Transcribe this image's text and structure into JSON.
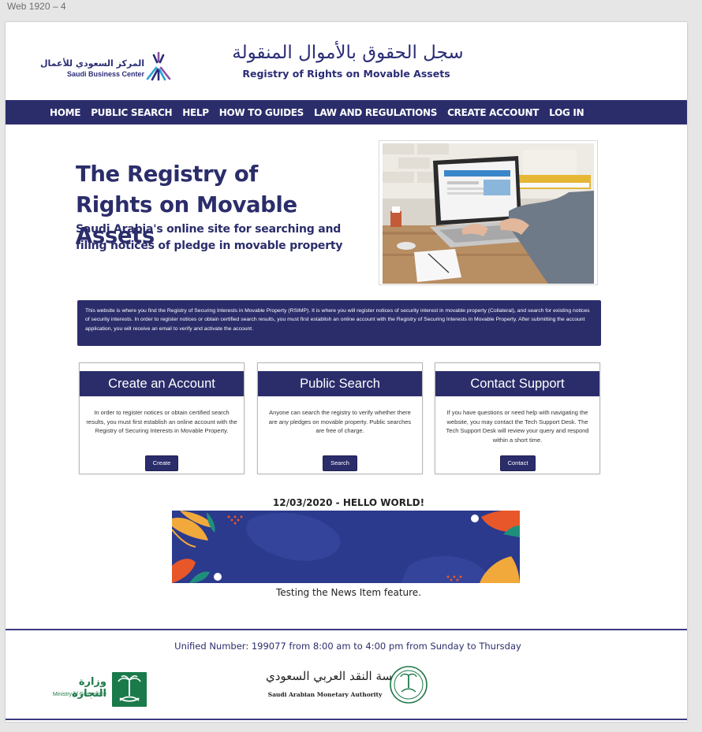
{
  "frame": {
    "title": "Web 1920 – 4"
  },
  "header": {
    "sbc_logo_ar": "المركز السعودي للأعمال",
    "sbc_logo_en": "Saudi Business Center",
    "title_ar": "سجل الحقوق بالأموال المنقولة",
    "title_en": "Registry of Rights on Movable Assets"
  },
  "nav": {
    "items": [
      {
        "label": "HOME"
      },
      {
        "label": "PUBLIC SEARCH"
      },
      {
        "label": "HELP"
      },
      {
        "label": "HOW TO GUIDES"
      },
      {
        "label": "LAW AND REGULATIONS"
      },
      {
        "label": "CREATE ACCOUNT"
      },
      {
        "label": "LOG IN"
      }
    ]
  },
  "hero": {
    "title_line1": "The Registry of",
    "title_line2": "Rights on Movable Assets",
    "subtitle_line1": "Saudi Arabia's online site for searching and",
    "subtitle_line2": "filing notices of pledge in movable property"
  },
  "intro": {
    "text": "This website is where you find the Registry of Securing Interests in Movable Property (RSIMP). It is where you will register notices of security interest in movable property (Collateral), and search for existing notices of security interests. In order to register notices or obtain certified search results, you must first establish an online account with the Registry of Securing Interests in Movable Property. After submitting the account application, you will receive an email to verify and activate the account."
  },
  "cards": [
    {
      "title": "Create an Account",
      "body": "In order to register notices or obtain certified search results, you must first establish an online account with the Registry of Securing Interests in Movable Property.",
      "button": "Create"
    },
    {
      "title": "Public Search",
      "body": "Anyone can search the registry to verify whether there are any pledges on movable property. Public searches are free of charge.",
      "button": "Search"
    },
    {
      "title": "Contact Support",
      "body": "If you have questions or need help with navigating the website, you may contact the Tech Support Desk. The Tech Support Desk will review your query and respond within a short time.",
      "button": "Contact"
    }
  ],
  "news": {
    "date_title": "12/03/2020 - HELLO WORLD!",
    "caption": "Testing the News Item feature."
  },
  "footer": {
    "unified": "Unified Number: 199077 from 8:00 am to 4:00 pm from Sunday to Thursday",
    "moc_ar": "وزارة التجارة",
    "moc_en": "Ministry of Commerce",
    "sama_ar": "مؤسسة النقد العربي السعودي",
    "sama_en": "Saudi Arabian Monetary Authority"
  },
  "colors": {
    "brand_navy": "#2b2d6b",
    "moc_green": "#1a7a4a",
    "banner_blue": "#2b3a8c",
    "banner_orange": "#e8572a"
  }
}
